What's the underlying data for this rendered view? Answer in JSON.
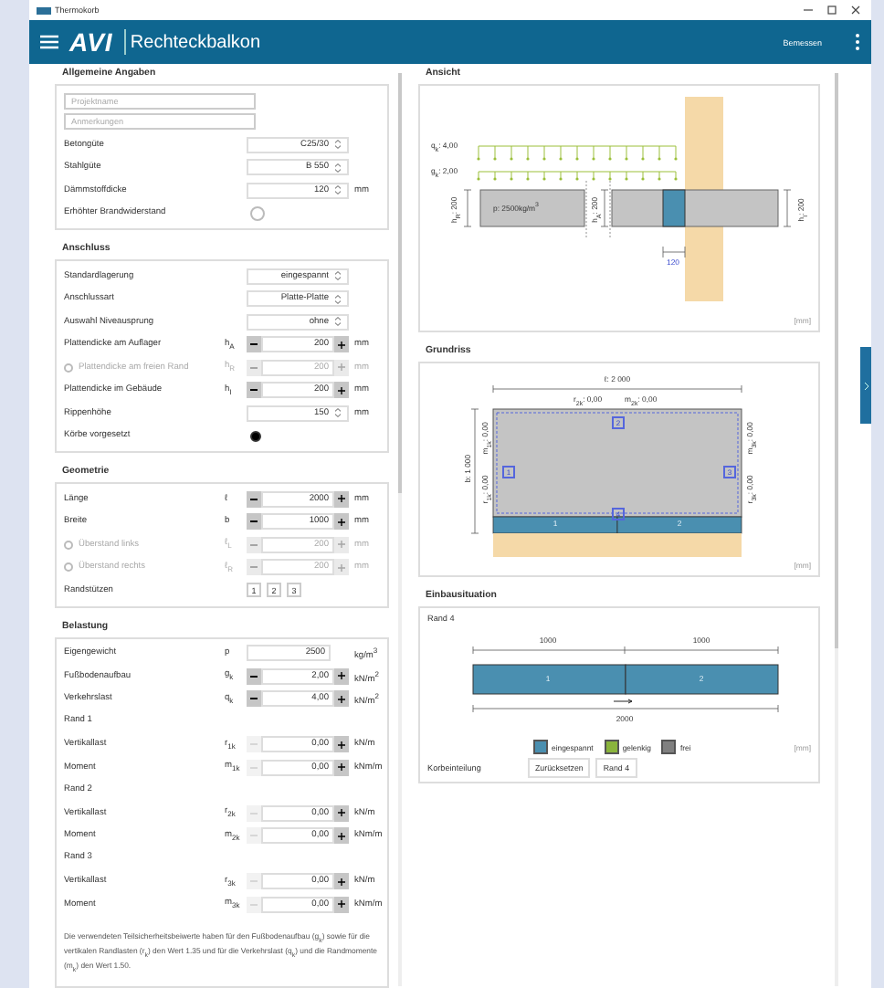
{
  "window": {
    "title": "Thermokorb"
  },
  "header": {
    "logo": "AVI",
    "title": "Rechteckbalkon",
    "action": "Bemessen"
  },
  "sections": [
    {
      "title": "Allgemeine Angaben",
      "rows": [
        {
          "kind": "field",
          "placeholder": "Projektname"
        },
        {
          "kind": "field",
          "placeholder": "Anmerkungen"
        },
        {
          "kind": "select",
          "label": "Betongüte",
          "value": "C25/30"
        },
        {
          "kind": "select",
          "label": "Stahlgüte",
          "value": "B 550"
        },
        {
          "kind": "select",
          "label": "Dämmstoffdicke",
          "value": "120",
          "unit": "mm"
        },
        {
          "kind": "toggle",
          "label": "Erhöhter Brandwiderstand",
          "checked": false
        }
      ]
    },
    {
      "title": "Anschluss",
      "rows": [
        {
          "kind": "select",
          "label": "Standardlagerung",
          "value": "eingespannt"
        },
        {
          "kind": "select",
          "label": "Anschlussart",
          "value": "Platte-Platte"
        },
        {
          "kind": "select",
          "label": "Auswahl Niveausprung",
          "value": "ohne"
        },
        {
          "kind": "stepper",
          "label": "Plattendicke am Auflager",
          "symbol": "h$_{A}$",
          "value": "200",
          "unit": "mm",
          "disabled": false,
          "at_min": false
        },
        {
          "kind": "stepper",
          "label": "Plattendicke am freien Rand",
          "symbol": "h$_{R}$",
          "value": "200",
          "unit": "mm",
          "disabled": true,
          "checked": false
        },
        {
          "kind": "stepper",
          "label": "Plattendicke im Gebäude",
          "symbol": "h$_{I}$",
          "value": "200",
          "unit": "mm",
          "disabled": false,
          "at_min": false
        },
        {
          "kind": "select",
          "label": "Rippenhöhe",
          "value": "150",
          "unit": "mm"
        },
        {
          "kind": "radio",
          "label": "Körbe vorgesetzt",
          "checked": true
        }
      ]
    },
    {
      "title": "Geometrie",
      "rows": [
        {
          "kind": "stepper",
          "label": "Länge",
          "symbol": "ℓ",
          "value": "2000",
          "unit": "mm",
          "disabled": false,
          "at_min": false
        },
        {
          "kind": "stepper",
          "label": "Breite",
          "symbol": "b",
          "value": "1000",
          "unit": "mm",
          "disabled": false,
          "at_min": false
        },
        {
          "kind": "stepper",
          "label": "Überstand links",
          "symbol": "ℓ$_{L}$",
          "value": "200",
          "unit": "mm",
          "disabled": true,
          "checked": false
        },
        {
          "kind": "stepper",
          "label": "Überstand rechts",
          "symbol": "ℓ$_{R}$",
          "value": "200",
          "unit": "mm",
          "disabled": true,
          "checked": false
        },
        {
          "kind": "buttons",
          "label": "Randstützen",
          "buttons": [
            "1",
            "2",
            "3"
          ]
        }
      ]
    },
    {
      "title": "Belastung",
      "rows": [
        {
          "kind": "input",
          "label": "Eigengewicht",
          "symbol": "p",
          "value": "2500",
          "unit": "kg/m$^{3}$"
        },
        {
          "kind": "stepper",
          "label": "Fußbodenaufbau",
          "symbol": "g$_{k}$",
          "value": "2,00",
          "unit": "kN/m$^{2}$",
          "disabled": false,
          "at_min": false
        },
        {
          "kind": "stepper",
          "label": "Verkehrslast",
          "symbol": "q$_{k}$",
          "value": "4,00",
          "unit": "kN/m$^{2}$",
          "disabled": false,
          "at_min": false
        },
        {
          "kind": "subheading",
          "label": "Rand 1"
        },
        {
          "kind": "stepper",
          "label": "Vertikallast",
          "symbol": "r$_{1k}$",
          "value": "0,00",
          "unit": "kN/m",
          "disabled": false,
          "at_min": true
        },
        {
          "kind": "stepper",
          "label": "Moment",
          "symbol": "m$_{1k}$",
          "value": "0,00",
          "unit": "kNm/m",
          "disabled": false,
          "at_min": true
        },
        {
          "kind": "subheading",
          "label": "Rand 2"
        },
        {
          "kind": "stepper",
          "label": "Vertikallast",
          "symbol": "r$_{2k}$",
          "value": "0,00",
          "unit": "kN/m",
          "disabled": false,
          "at_min": true
        },
        {
          "kind": "stepper",
          "label": "Moment",
          "symbol": "m$_{2k}$",
          "value": "0,00",
          "unit": "kNm/m",
          "disabled": false,
          "at_min": true
        },
        {
          "kind": "subheading",
          "label": "Rand 3"
        },
        {
          "kind": "stepper",
          "label": "Vertikallast",
          "symbol": "r$_{3k}$",
          "value": "0,00",
          "unit": "kN/m",
          "disabled": false,
          "at_min": true
        },
        {
          "kind": "stepper",
          "label": "Moment",
          "symbol": "m$_{3k}$",
          "value": "0,00",
          "unit": "kNm/m",
          "disabled": false,
          "at_min": true
        },
        {
          "kind": "note",
          "text": "Die verwendeten Teilsicherheitsbeiwerte haben für den Fußbodenaufbau (g$_{k}$) sowie für die vertikalen Randlasten (r$_{k}$) den Wert 1.35 und für die Verkehrslast (q$_{k}$) und die Randmomente (m$_{k}$) den Wert 1.50."
        }
      ]
    }
  ],
  "view": {
    "title": "Ansicht",
    "loads": [
      "q$_{k}$: 4,00",
      "g$_{k}$: 2,00"
    ],
    "weight": "p: 2500kg/m$^{3}$",
    "heights": [
      "h$_{R}$: 200",
      "h$_{A}$: 200",
      "h$_{I}$: 200"
    ],
    "insulation": "120",
    "unit": "[mm]"
  },
  "plan": {
    "title": "Grundriss",
    "length": "ℓ: 2 000",
    "width": "b: 1 000",
    "top_loads": [
      "r$_{2k}$: 0,00",
      "m$_{2k}$: 0,00"
    ],
    "left_loads": [
      "m$_{1k}$: 0,00",
      "r$_{1k}$: 0,00"
    ],
    "right_loads": [
      "m$_{3k}$: 0,00",
      "r$_{3k}$: 0,00"
    ],
    "edges": [
      "2",
      "1",
      "3",
      "4"
    ],
    "segments": [
      {
        "label": "1",
        "color": "#4a8fb0"
      },
      {
        "label": "2",
        "color": "#4a8fb0"
      }
    ],
    "unit": "[mm]"
  },
  "installation": {
    "title": "Einbausituation",
    "edge": "Rand 4",
    "lengths": [
      "1000",
      "1000"
    ],
    "total": "2000",
    "segments": [
      {
        "label": "1",
        "color": "#4a8fb0"
      },
      {
        "label": "2",
        "color": "#4a8fb0"
      }
    ],
    "legend": [
      {
        "label": "eingespannt",
        "color": "#4a8fb0"
      },
      {
        "label": "gelenkig",
        "color": "#8ab43c"
      },
      {
        "label": "frei",
        "color": "#808080"
      }
    ],
    "unit": "[mm]",
    "layout_label": "Korbeinteilung",
    "buttons": [
      "Zurücksetzen",
      "Rand 4"
    ]
  }
}
